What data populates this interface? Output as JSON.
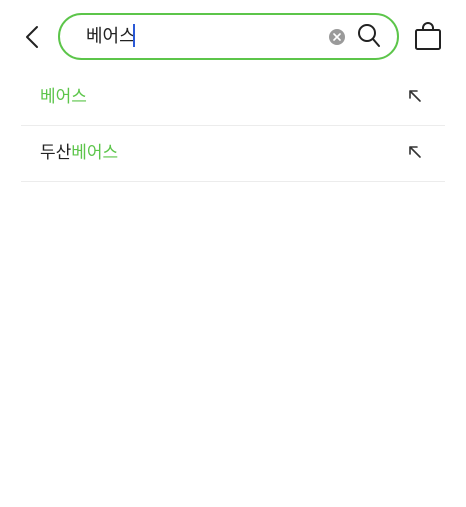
{
  "search": {
    "value": "베어스",
    "accent_color": "#5cc54a",
    "caret_color": "#2b59d6"
  },
  "icons": {
    "back": "chevron-left-icon",
    "clear": "clear-circle-x-icon",
    "search": "magnifier-icon",
    "bag": "shopping-bag-icon",
    "fill": "arrow-up-left-icon"
  },
  "suggestions": [
    {
      "prefix": "",
      "highlight": "베어스"
    },
    {
      "prefix": "두산",
      "highlight": "베어스"
    }
  ]
}
